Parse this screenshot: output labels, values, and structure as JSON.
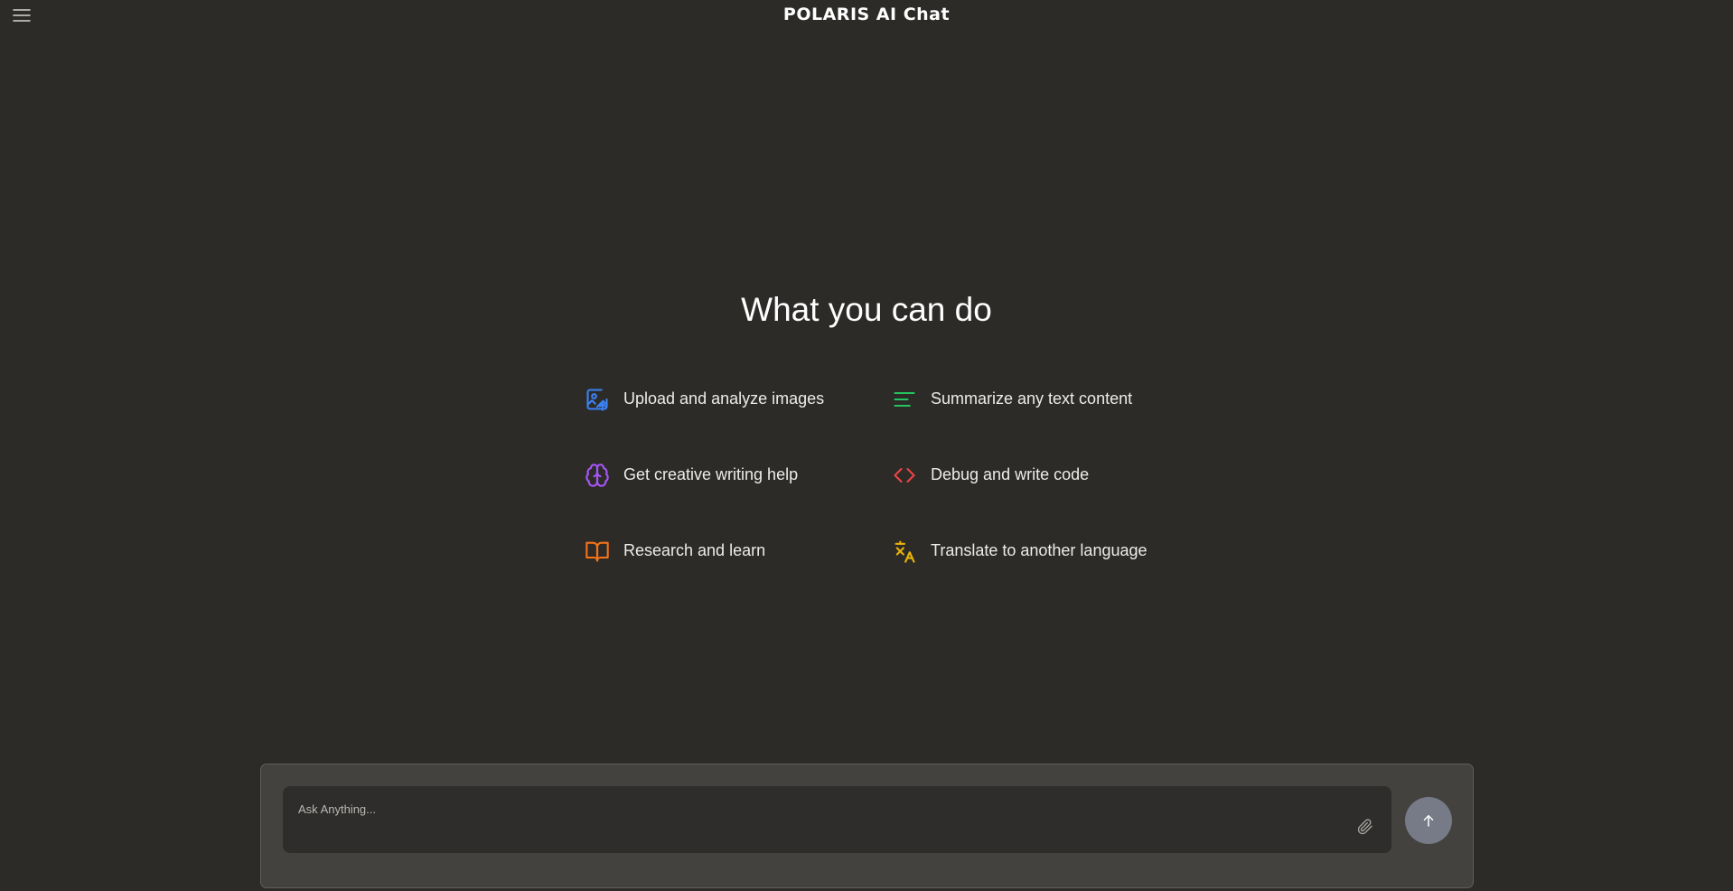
{
  "header": {
    "title": "POLARIS AI Chat",
    "menu_icon": "hamburger-menu-icon"
  },
  "main": {
    "heading": "What you can do",
    "features": [
      {
        "label": "Upload and analyze images",
        "icon": "image-upload-icon",
        "color": "#3b82f6"
      },
      {
        "label": "Summarize any text content",
        "icon": "text-lines-icon",
        "color": "#22c55e"
      },
      {
        "label": "Get creative writing help",
        "icon": "brain-icon",
        "color": "#a855f7"
      },
      {
        "label": "Debug and write code",
        "icon": "code-brackets-icon",
        "color": "#ef4444"
      },
      {
        "label": "Research and learn",
        "icon": "open-book-icon",
        "color": "#f97316"
      },
      {
        "label": "Translate to another language",
        "icon": "translate-icon",
        "color": "#eab308"
      }
    ]
  },
  "composer": {
    "placeholder": "Ask Anything...",
    "value": "",
    "attach_icon": "paperclip-icon",
    "send_icon": "arrow-up-icon"
  },
  "colors": {
    "background": "#2c2b28",
    "composer_panel": "#43423f",
    "input_background": "#2e2d2b",
    "send_button": "#767b87"
  }
}
